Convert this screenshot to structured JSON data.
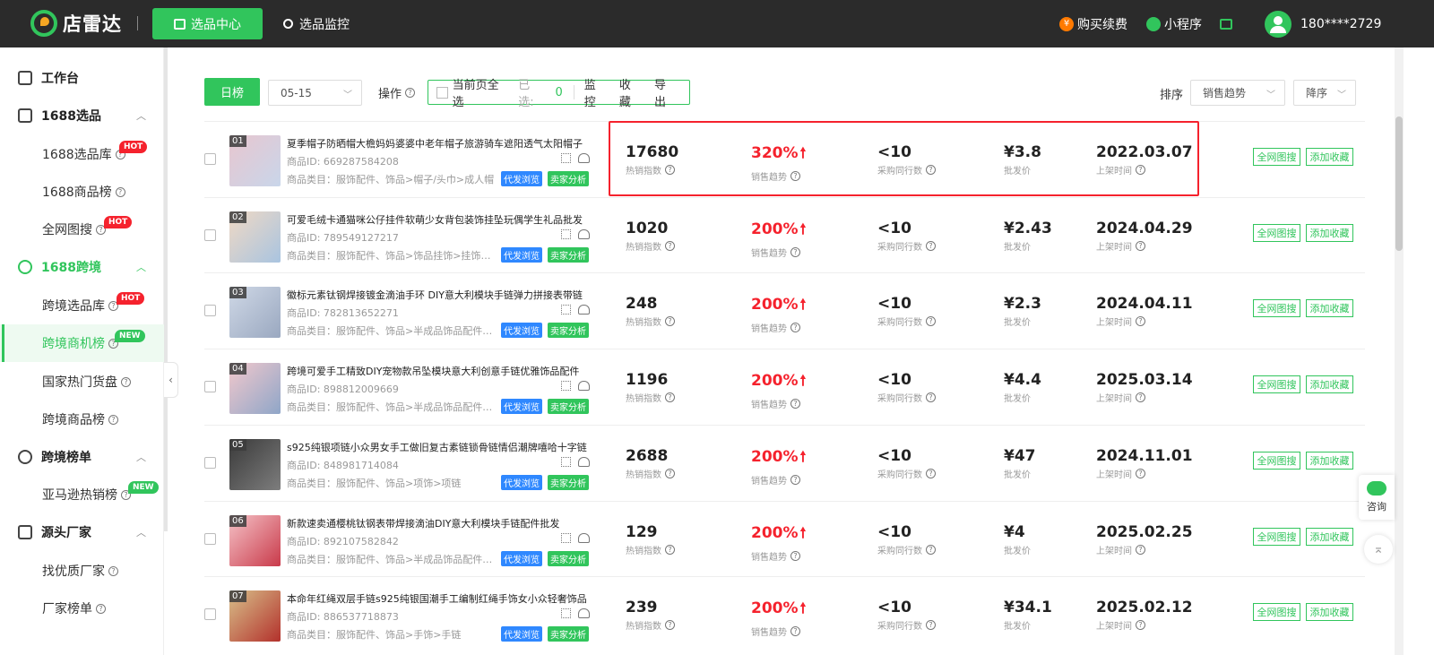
{
  "header": {
    "logo_text": "店雷达",
    "nav_active": "选品中心",
    "nav_monitor": "选品监控",
    "buy": "购买续费",
    "buy_icon": "¥",
    "mini_program": "小程序",
    "user": "180****2729"
  },
  "sidebar": {
    "workbench": "工作台",
    "g1688": "1688选品",
    "items_1688": [
      {
        "label": "1688选品库",
        "badge": "HOT"
      },
      {
        "label": "1688商品榜",
        "badge": ""
      },
      {
        "label": "全网图搜",
        "badge": "HOT"
      }
    ],
    "gcross": "1688跨境",
    "items_cross": [
      {
        "label": "跨境选品库",
        "badge": "HOT"
      },
      {
        "label": "跨境商机榜",
        "badge": "NEW"
      },
      {
        "label": "国家热门货盘",
        "badge": ""
      },
      {
        "label": "跨境商品榜",
        "badge": ""
      }
    ],
    "granking": "跨境榜单",
    "items_ranking": [
      {
        "label": "亚马逊热销榜",
        "badge": "NEW"
      }
    ],
    "gfactory": "源头厂家",
    "items_factory": [
      {
        "label": "找优质厂家",
        "badge": ""
      },
      {
        "label": "厂家榜单",
        "badge": ""
      }
    ],
    "collapse_icon": "‹",
    "active_color": "#31c55c"
  },
  "toolbar": {
    "day_button": "日榜",
    "date": "05-15",
    "op_label": "操作",
    "select_page": "当前页全选",
    "selected_label": "已选:",
    "selected_count": "0",
    "monitor": "监控",
    "collect": "收藏",
    "export": "导出",
    "sort_label": "排序",
    "sort_field": "销售趋势",
    "sort_order": "降序"
  },
  "labels": {
    "product_id": "商品ID:",
    "hot_index": "热销指数",
    "trend": "销售趋势",
    "peers": "采购同行数",
    "price": "批发价",
    "listed": "上架时间",
    "tag_dropship": "代发浏览",
    "tag_seller": "卖家分析",
    "btn_image_search": "全网图搜",
    "btn_collect": "添加收藏",
    "help": "?",
    "up_arrow": "🠕"
  },
  "products": [
    {
      "idx": "01",
      "name": "夏季帽子防晒帽大檐妈妈婆婆中老年帽子旅游骑车遮阳透气太阳帽子",
      "id": "669287584208",
      "cat": "商品类目：服饰配件、饰品>帽子/头巾>成人帽",
      "hot": "17680",
      "trend": "320%",
      "peers": "<10",
      "price": "¥3.8",
      "date": "2022.03.07",
      "c1": "#e8c6cf",
      "c2": "#c9d6ea"
    },
    {
      "idx": "02",
      "name": "可爱毛绒卡通猫咪公仔挂件软萌少女背包装饰挂坠玩偶学生礼品批发",
      "id": "789549127217",
      "cat": "商品类目：服饰配件、饰品>饰品挂饰>挂饰挂件",
      "hot": "1020",
      "trend": "200%",
      "peers": "<10",
      "price": "¥2.43",
      "date": "2024.04.29",
      "c1": "#f0d9c4",
      "c2": "#a9c4e0"
    },
    {
      "idx": "03",
      "name": "徽标元素钛钢焊接镀金滴油手环 DIY意大利模块手链弹力拼接表带链",
      "id": "782813652271",
      "cat": "商品类目：服饰配件、饰品>半成品饰品配件>...",
      "hot": "248",
      "trend": "200%",
      "peers": "<10",
      "price": "¥2.3",
      "date": "2024.04.11",
      "c1": "#cfd8e6",
      "c2": "#9aa8c0"
    },
    {
      "idx": "04",
      "name": "跨境可爱手工精致DIY宠物款吊坠模块意大利创意手链优雅饰品配件",
      "id": "898812009669",
      "cat": "商品类目：服饰配件、饰品>半成品饰品配件>...",
      "hot": "1196",
      "trend": "200%",
      "peers": "<10",
      "price": "¥4.4",
      "date": "2025.03.14",
      "c1": "#f2c8cc",
      "c2": "#8fa6c8"
    },
    {
      "idx": "05",
      "name": "s925纯银项链小众男女手工做旧复古素链锁骨链情侣潮牌嘻哈十字链",
      "id": "848981714084",
      "cat": "商品类目：服饰配件、饰品>项饰>项链",
      "hot": "2688",
      "trend": "200%",
      "peers": "<10",
      "price": "¥47",
      "date": "2024.11.01",
      "c1": "#3a3a3a",
      "c2": "#7d7d7d"
    },
    {
      "idx": "06",
      "name": "新款速卖通樱桃钛钢表带焊接滴油DIY意大利模块手链配件批发",
      "id": "892107582842",
      "cat": "商品类目：服饰配件、饰品>半成品饰品配件>...",
      "hot": "129",
      "trend": "200%",
      "peers": "<10",
      "price": "¥4",
      "date": "2025.02.25",
      "c1": "#f5c2c7",
      "c2": "#c93a4a"
    },
    {
      "idx": "07",
      "name": "本命年红绳双层手链s925纯银国潮手工编制红绳手饰女小众轻奢饰品",
      "id": "886537718873",
      "cat": "商品类目：服饰配件、饰品>手饰>手链",
      "hot": "239",
      "trend": "200%",
      "peers": "<10",
      "price": "¥34.1",
      "date": "2025.02.12",
      "c1": "#d8c08a",
      "c2": "#b3312c"
    }
  ],
  "floating": {
    "consult": "咨询",
    "top_icon": "⌅"
  },
  "colors": {
    "brand_green": "#31c55c",
    "trend_red": "#f5222d",
    "tag_blue": "#2f88ff"
  }
}
